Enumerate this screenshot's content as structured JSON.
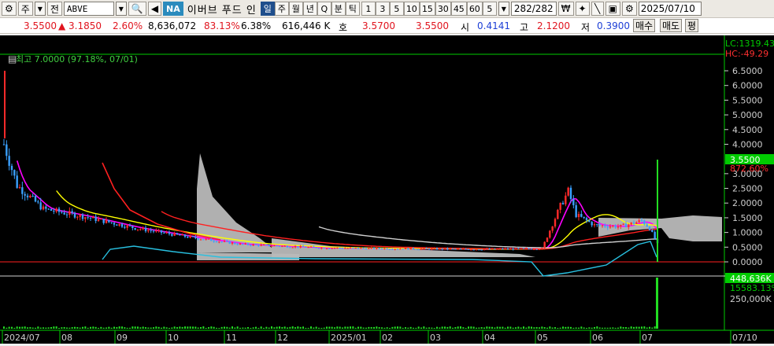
{
  "toolbar": {
    "market_type": "주",
    "market_all": "전",
    "ticker": "ABVE",
    "na_badge": "NA",
    "stock_name": "이버브 푸드 인",
    "periods_word": [
      "일",
      "주",
      "월",
      "년",
      "Q",
      "분",
      "틱"
    ],
    "periods_num": [
      "1",
      "3",
      "5",
      "10",
      "15",
      "30",
      "45",
      "60",
      "5"
    ],
    "count": "282/282",
    "date": "2025/07/10"
  },
  "quote": {
    "price": "3.5500",
    "change": "▲ 3.1850",
    "change_pct": "2.60%",
    "volume": "8,636,072",
    "vol_ratio": "83.13%",
    "turnover": "6.38%",
    "amount": "616,446 K",
    "ask_label": "호",
    "ask": "3.5700",
    "bid": "3.5500",
    "open_label": "시",
    "open": "0.4141",
    "high_label": "고",
    "high": "2.1200",
    "low_label": "저",
    "low": "0.3900",
    "buy_label": "매수",
    "sell_label": "매도",
    "avg_label": "평"
  },
  "chart": {
    "high_note": "최고 7.0000 (97.18%, 07/01)",
    "lc_label": "LC:1319.43",
    "hc_label": "HC:-49.29",
    "current_price_tag": "3.5500",
    "current_pct_tag": "872.60%",
    "volume_tag": "448,636K",
    "volume_sub": "15583.13%",
    "vol_axis_label": "250,000K",
    "price_axis": [
      "6.5000",
      "6.0000",
      "5.5000",
      "5.0000",
      "4.5000",
      "4.0000",
      "3.0000",
      "2.5000",
      "2.0000",
      "1.5000",
      "1.0000",
      "0.5000",
      "0.0000"
    ],
    "date_axis": [
      "2024/07",
      "08",
      "09",
      "10",
      "11",
      "12",
      "2025/01",
      "02",
      "03",
      "04",
      "05",
      "06",
      "07",
      "07/10"
    ]
  },
  "chart_data": {
    "type": "line",
    "title": "",
    "xlabel": "",
    "ylabel": "",
    "ylim": [
      0,
      7.0
    ],
    "x": [
      "2024/07",
      "08",
      "09",
      "10",
      "11",
      "12",
      "2025/01",
      "02",
      "03",
      "04",
      "05",
      "06",
      "07"
    ],
    "series": [
      {
        "values": [
          4.0,
          1.6,
          0.9,
          0.6,
          0.45,
          0.45,
          0.45,
          0.45,
          0.45,
          0.45,
          1.8,
          1.3,
          1.1
        ]
      }
    ],
    "colors": {
      "up": "#ff2a2a",
      "down": "#3aa0ff",
      "ma5": "#ff00ff",
      "ma20": "#ffff00",
      "ma60": "#ff2020",
      "ma120": "#cfcfcf",
      "ma240": "#28c0e0",
      "cloud": "#b9b9b9",
      "volume": "#22dd22",
      "grid": "#00cc00"
    }
  }
}
